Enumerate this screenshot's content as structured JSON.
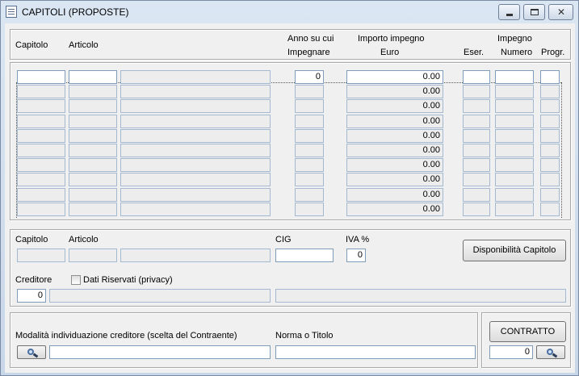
{
  "window": {
    "title": "CAPITOLI (PROPOSTE)"
  },
  "grid": {
    "headers": {
      "capitolo": "Capitolo",
      "articolo": "Articolo",
      "anno_line1": "Anno su cui",
      "anno_line2": "Impegnare",
      "importo_line1": "Importo impegno",
      "importo_line2": "Euro",
      "eser": "Eser.",
      "impegno_line1": "Impegno",
      "impegno_line2": "Numero",
      "progr": "Progr."
    },
    "rows": [
      {
        "anno": "0",
        "importo": "0.00"
      },
      {
        "anno": "",
        "importo": "0.00"
      },
      {
        "anno": "",
        "importo": "0.00"
      },
      {
        "anno": "",
        "importo": "0.00"
      },
      {
        "anno": "",
        "importo": "0.00"
      },
      {
        "anno": "",
        "importo": "0.00"
      },
      {
        "anno": "",
        "importo": "0.00"
      },
      {
        "anno": "",
        "importo": "0.00"
      },
      {
        "anno": "",
        "importo": "0.00"
      },
      {
        "anno": "",
        "importo": "0.00"
      }
    ]
  },
  "detail": {
    "capitolo_label": "Capitolo",
    "articolo_label": "Articolo",
    "cig_label": "CIG",
    "iva_label": "IVA %",
    "iva_value": "0",
    "disponibilita_button": "Disponibilità Capitolo",
    "creditore_label": "Creditore",
    "creditore_value": "0",
    "dati_riservati_label": "Dati Riservati (privacy)"
  },
  "bottom": {
    "modalita_label": "Modalità individuazione creditore (scelta del Contraente)",
    "norma_label": "Norma o Titolo",
    "contratto_button": "CONTRATTO",
    "contratto_value": "0"
  },
  "icons": {
    "app": "form-icon",
    "minimize": "minimize-icon",
    "maximize": "maximize-icon",
    "close": "close-icon",
    "lookup": "magnifier-icon"
  }
}
